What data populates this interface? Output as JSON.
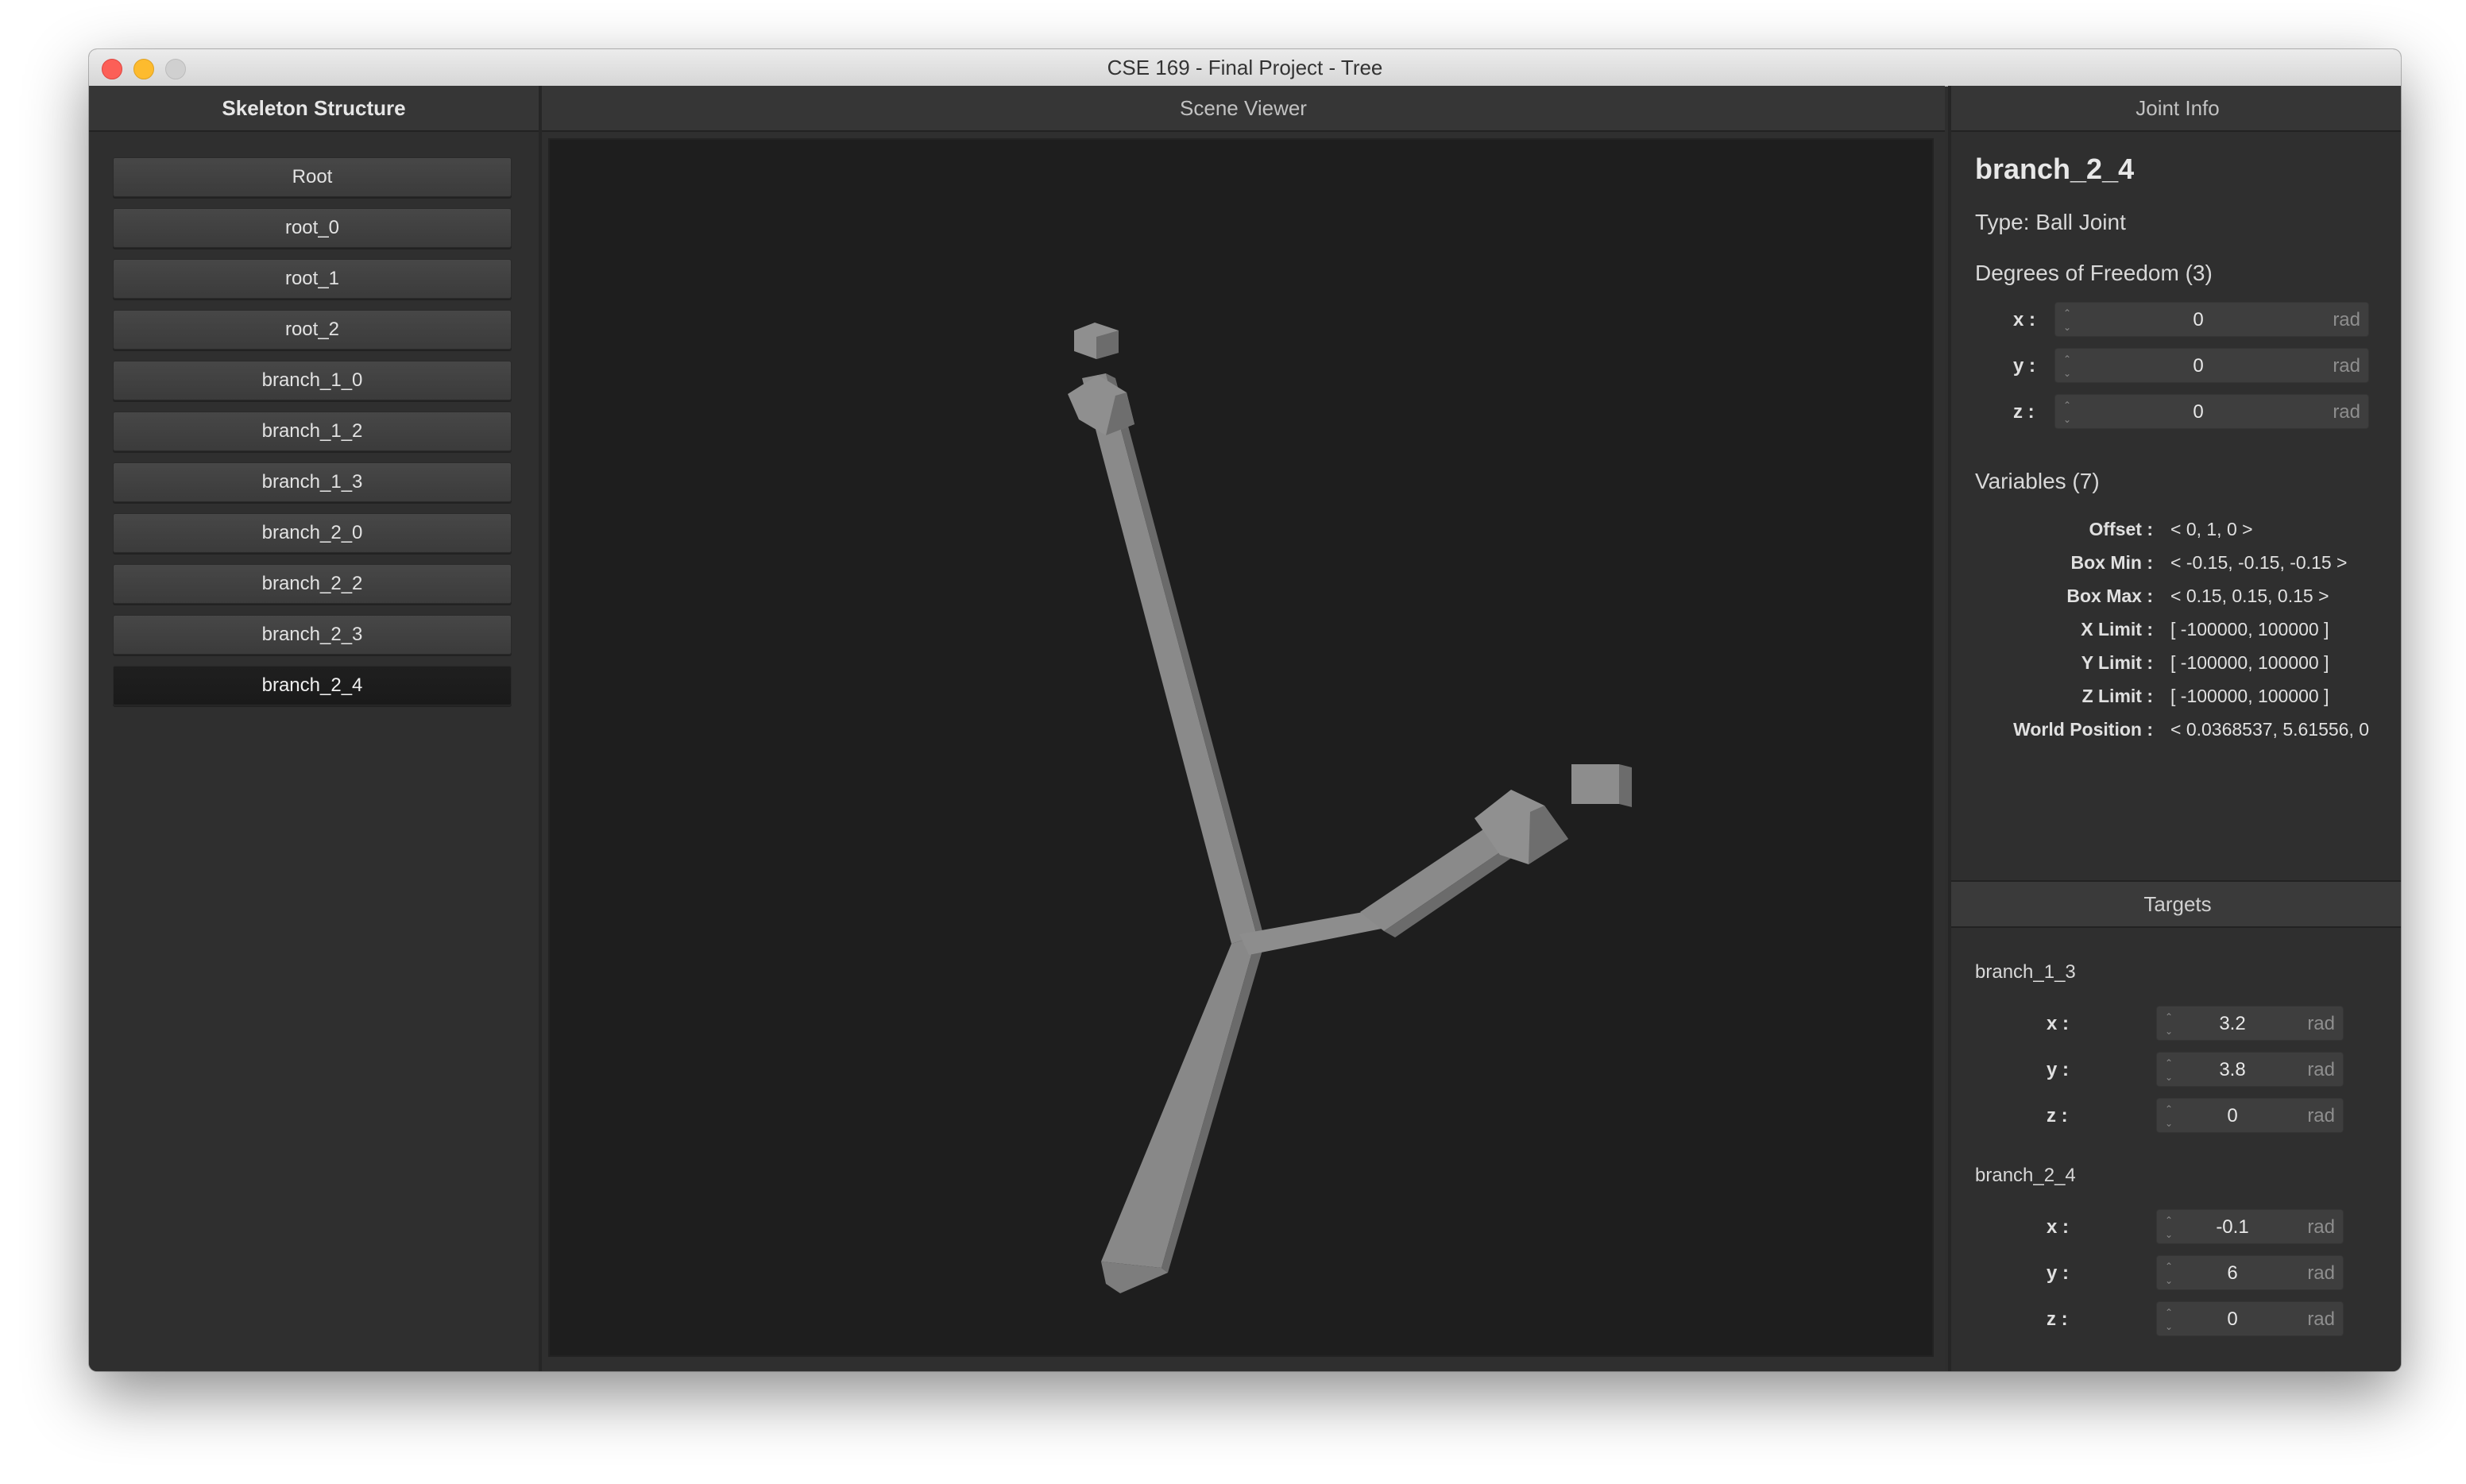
{
  "window": {
    "title": "CSE 169 - Final Project - Tree"
  },
  "skeleton": {
    "header": "Skeleton Structure",
    "joints": [
      {
        "label": "Root",
        "selected": false
      },
      {
        "label": "root_0",
        "selected": false
      },
      {
        "label": "root_1",
        "selected": false
      },
      {
        "label": "root_2",
        "selected": false
      },
      {
        "label": "branch_1_0",
        "selected": false
      },
      {
        "label": "branch_1_2",
        "selected": false
      },
      {
        "label": "branch_1_3",
        "selected": false
      },
      {
        "label": "branch_2_0",
        "selected": false
      },
      {
        "label": "branch_2_2",
        "selected": false
      },
      {
        "label": "branch_2_3",
        "selected": false
      },
      {
        "label": "branch_2_4",
        "selected": true
      }
    ]
  },
  "scene": {
    "header": "Scene Viewer"
  },
  "joint_info": {
    "header": "Joint Info",
    "name": "branch_2_4",
    "type": "Type: Ball Joint",
    "dof_title": "Degrees of Freedom (3)",
    "dof": [
      {
        "label": "x :",
        "value": "0",
        "unit": "rad"
      },
      {
        "label": "y :",
        "value": "0",
        "unit": "rad"
      },
      {
        "label": "z :",
        "value": "0",
        "unit": "rad"
      }
    ],
    "variables_title": "Variables (7)",
    "variables": [
      {
        "label": "Offset :",
        "value": "< 0, 1, 0 >"
      },
      {
        "label": "Box Min :",
        "value": "< -0.15, -0.15, -0.15 >"
      },
      {
        "label": "Box Max :",
        "value": "< 0.15, 0.15, 0.15 >"
      },
      {
        "label": "X Limit :",
        "value": "[ -100000, 100000 ]"
      },
      {
        "label": "Y Limit :",
        "value": "[ -100000, 100000 ]"
      },
      {
        "label": "Z Limit :",
        "value": "[ -100000, 100000 ]"
      },
      {
        "label": "World Position :",
        "value": "< 0.0368537, 5.61556, 0"
      }
    ]
  },
  "targets": {
    "header": "Targets",
    "groups": [
      {
        "name": "branch_1_3",
        "fields": [
          {
            "label": "x :",
            "value": "3.2",
            "unit": "rad"
          },
          {
            "label": "y :",
            "value": "3.8",
            "unit": "rad"
          },
          {
            "label": "z :",
            "value": "0",
            "unit": "rad"
          }
        ]
      },
      {
        "name": "branch_2_4",
        "fields": [
          {
            "label": "x :",
            "value": "-0.1",
            "unit": "rad"
          },
          {
            "label": "y :",
            "value": "6",
            "unit": "rad"
          },
          {
            "label": "z :",
            "value": "0",
            "unit": "rad"
          }
        ]
      }
    ]
  }
}
